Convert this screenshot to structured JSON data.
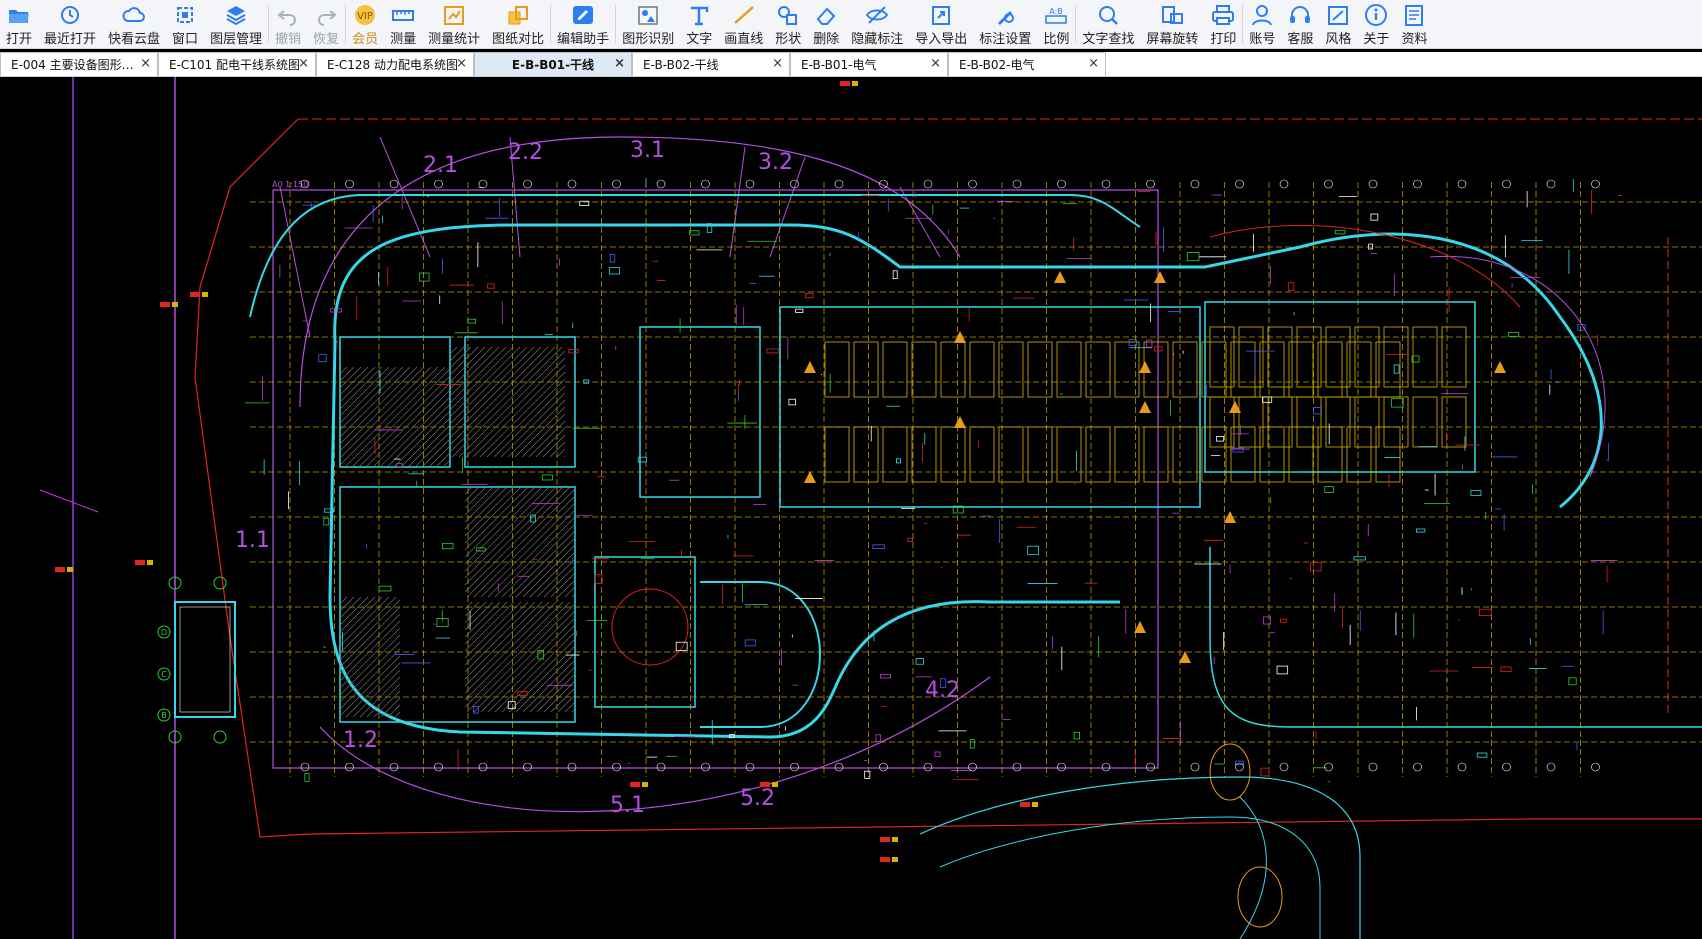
{
  "toolbar": {
    "items": [
      {
        "label": "打开",
        "icon": "folder-open-icon"
      },
      {
        "label": "最近打开",
        "icon": "recent-clock-icon"
      },
      {
        "label": "快看云盘",
        "icon": "cloud-icon"
      },
      {
        "label": "窗口",
        "icon": "window-icon"
      },
      {
        "label": "图层管理",
        "icon": "layers-icon"
      },
      {
        "label": "撤销",
        "icon": "undo-icon"
      },
      {
        "label": "恢复",
        "icon": "redo-icon"
      },
      {
        "label": "会员",
        "icon": "vip-icon"
      },
      {
        "label": "测量",
        "icon": "measure-icon"
      },
      {
        "label": "测量统计",
        "icon": "measure-stats-icon"
      },
      {
        "label": "图纸对比",
        "icon": "compare-icon"
      },
      {
        "label": "编辑助手",
        "icon": "edit-assistant-icon"
      },
      {
        "label": "图形识别",
        "icon": "shape-recognize-icon"
      },
      {
        "label": "文字",
        "icon": "text-icon"
      },
      {
        "label": "画直线",
        "icon": "line-icon"
      },
      {
        "label": "形状",
        "icon": "shape-icon"
      },
      {
        "label": "删除",
        "icon": "eraser-icon"
      },
      {
        "label": "隐藏标注",
        "icon": "hide-eye-icon"
      },
      {
        "label": "导入导出",
        "icon": "import-export-icon"
      },
      {
        "label": "标注设置",
        "icon": "annotation-settings-icon"
      },
      {
        "label": "比例",
        "icon": "scale-icon"
      },
      {
        "label": "文字查找",
        "icon": "text-search-icon"
      },
      {
        "label": "屏幕旋转",
        "icon": "rotate-screen-icon"
      },
      {
        "label": "打印",
        "icon": "print-icon"
      },
      {
        "label": "账号",
        "icon": "account-icon"
      },
      {
        "label": "客服",
        "icon": "headset-icon"
      },
      {
        "label": "风格",
        "icon": "style-icon"
      },
      {
        "label": "关于",
        "icon": "info-icon"
      },
      {
        "label": "资料",
        "icon": "documents-icon"
      }
    ]
  },
  "tabs": [
    {
      "label": "E-004 主要设备图形…",
      "close": "×",
      "active": false
    },
    {
      "label": "E-C101 配电干线系统图",
      "close": "×",
      "active": false
    },
    {
      "label": "E-C128 动力配电系统图",
      "close": "×",
      "active": false
    },
    {
      "label": "E-B-B01-干线",
      "close": "×",
      "active": true
    },
    {
      "label": "E-B-B02-干线",
      "close": "×",
      "active": false
    },
    {
      "label": "E-B-B01-电气",
      "close": "×",
      "active": false
    },
    {
      "label": "E-B-B02-电气",
      "close": "×",
      "active": false
    }
  ],
  "drawing": {
    "scale_label": "A0 1:150",
    "zones": [
      "2.1",
      "2.2",
      "3.1",
      "3.2",
      "1.1",
      "1.2",
      "4.2",
      "5.1",
      "5.2"
    ],
    "axis_labels": [
      "D",
      "C",
      "B"
    ],
    "colors": {
      "background": "#000000",
      "cyan": "#35d7e8",
      "yellow": "#d9b300",
      "magenta": "#c23bd8",
      "red": "#e02424",
      "white": "#ffffff",
      "green": "#2fd02f",
      "orange": "#e89b1a",
      "blue": "#4d5bff"
    }
  }
}
